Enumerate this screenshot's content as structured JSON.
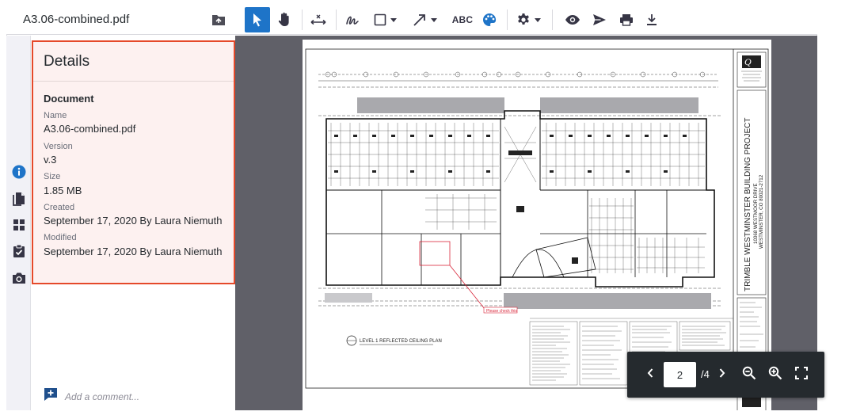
{
  "header": {
    "file_name": "A3.06-combined.pdf",
    "folder_icon": "folder-icon"
  },
  "toolbar": {
    "tools": [
      {
        "name": "select-tool",
        "icon": "cursor-arrow-icon",
        "active": true
      },
      {
        "name": "pan-tool",
        "icon": "hand-icon"
      },
      {
        "name": "measure-tool",
        "icon": "measure-icon"
      },
      {
        "name": "freehand-tool",
        "icon": "freehand-signature-icon"
      },
      {
        "name": "shape-tool",
        "icon": "square-icon"
      },
      {
        "name": "line-tool",
        "icon": "arrow-line-icon"
      },
      {
        "name": "text-tool",
        "label": "ABC"
      },
      {
        "name": "color-tool",
        "icon": "palette-icon"
      },
      {
        "name": "settings-tool",
        "icon": "gear-icon"
      },
      {
        "name": "view-tool",
        "icon": "eye-icon"
      },
      {
        "name": "send-tool",
        "icon": "send-icon"
      },
      {
        "name": "print-tool",
        "icon": "print-icon"
      },
      {
        "name": "download-tool",
        "icon": "download-icon"
      }
    ],
    "text_tool_label": "ABC"
  },
  "rail": {
    "items": [
      {
        "name": "info",
        "icon": "info-icon",
        "active": true
      },
      {
        "name": "documents",
        "icon": "document-icon"
      },
      {
        "name": "thumbnails",
        "icon": "grid-icon"
      },
      {
        "name": "tasks",
        "icon": "clipboard-check-icon"
      },
      {
        "name": "snapshots",
        "icon": "camera-icon"
      }
    ]
  },
  "details": {
    "title": "Details",
    "section": "Document",
    "name_label": "Name",
    "name_value": "A3.06-combined.pdf",
    "version_label": "Version",
    "version_value": "v.3",
    "size_label": "Size",
    "size_value": "1.85 MB",
    "created_label": "Created",
    "created_value": "September 17, 2020 By Laura Niemuth",
    "modified_label": "Modified",
    "modified_value": "September 17, 2020 By Laura Niemuth"
  },
  "comment": {
    "placeholder": "Add a comment..."
  },
  "drawing": {
    "project_title": "TRIMBLE WESTMINSTER BUILDING PROJECT",
    "address_line1": "10368 WESTMOOR DRIVE",
    "address_line2": "WESTMINSTER, CO 80021-2712",
    "plan_title": "LEVEL 1 REFLECTED CEILING PLAN",
    "markup_label": "Please check this"
  },
  "pager": {
    "current_page": "2",
    "total_pages": "/4"
  },
  "colors": {
    "accent": "#1e74c8",
    "highlight_border": "#e5492a",
    "highlight_fill": "#fdf1f0",
    "viewer_bg": "#606068",
    "pager_bg": "#252a2e"
  }
}
